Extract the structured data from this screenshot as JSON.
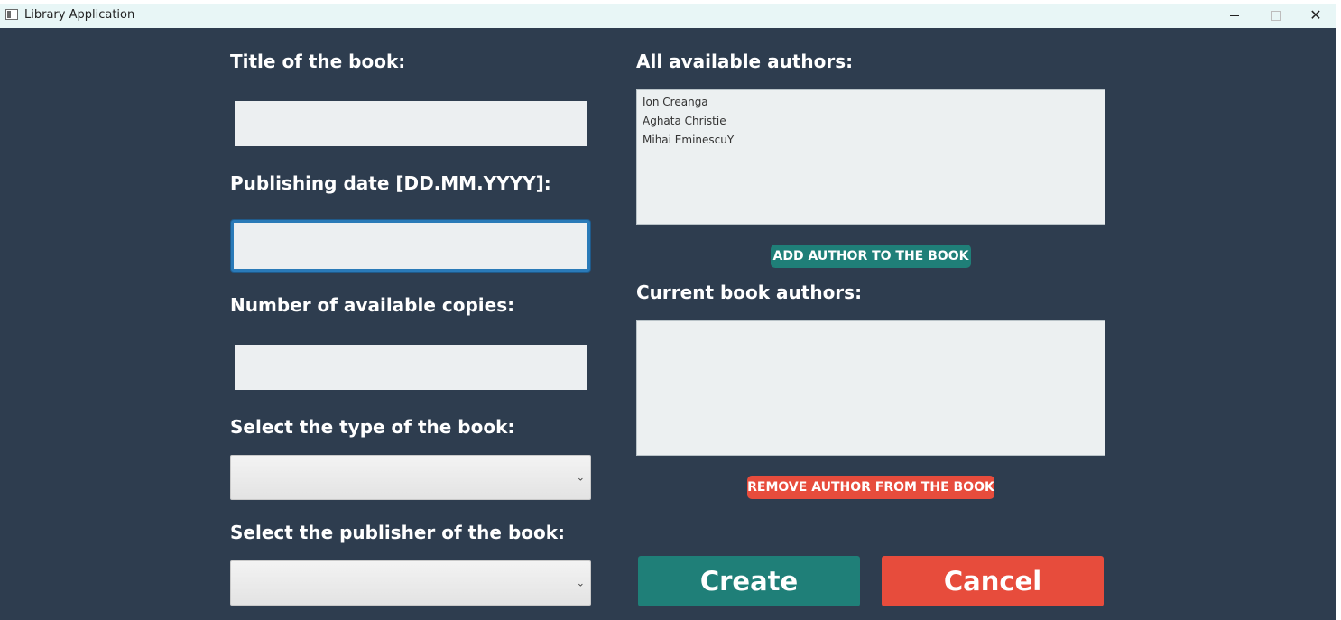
{
  "window": {
    "title": "Library Application",
    "controls": {
      "minimize": "minimize",
      "maximize": "maximize",
      "close": "close"
    }
  },
  "form": {
    "title_label": "Title of the book:",
    "title_value": "",
    "date_label": "Publishing date [DD.MM.YYYY]:",
    "date_value": "",
    "copies_label": "Number of available copies:",
    "copies_value": "",
    "type_label": "Select the type of the book:",
    "type_value": "",
    "publisher_label": "Select the publisher of the book:",
    "publisher_value": ""
  },
  "authors": {
    "available_label": "All available authors:",
    "available_items": [
      "Ion Creanga",
      "Aghata Christie",
      "Mihai EminescuY"
    ],
    "add_button": "ADD AUTHOR TO THE BOOK",
    "current_label": "Current book authors:",
    "current_items": [],
    "remove_button": "REMOVE AUTHOR FROM THE BOOK"
  },
  "actions": {
    "create": "Create",
    "cancel": "Cancel"
  },
  "colors": {
    "background": "#2e3d4f",
    "teal": "#1f7f78",
    "red": "#e74c3c",
    "field": "#eceff1",
    "focus": "#2a7ab8"
  },
  "icons": {
    "app": "app-window-icon",
    "dropdown": "chevron-down-icon"
  }
}
